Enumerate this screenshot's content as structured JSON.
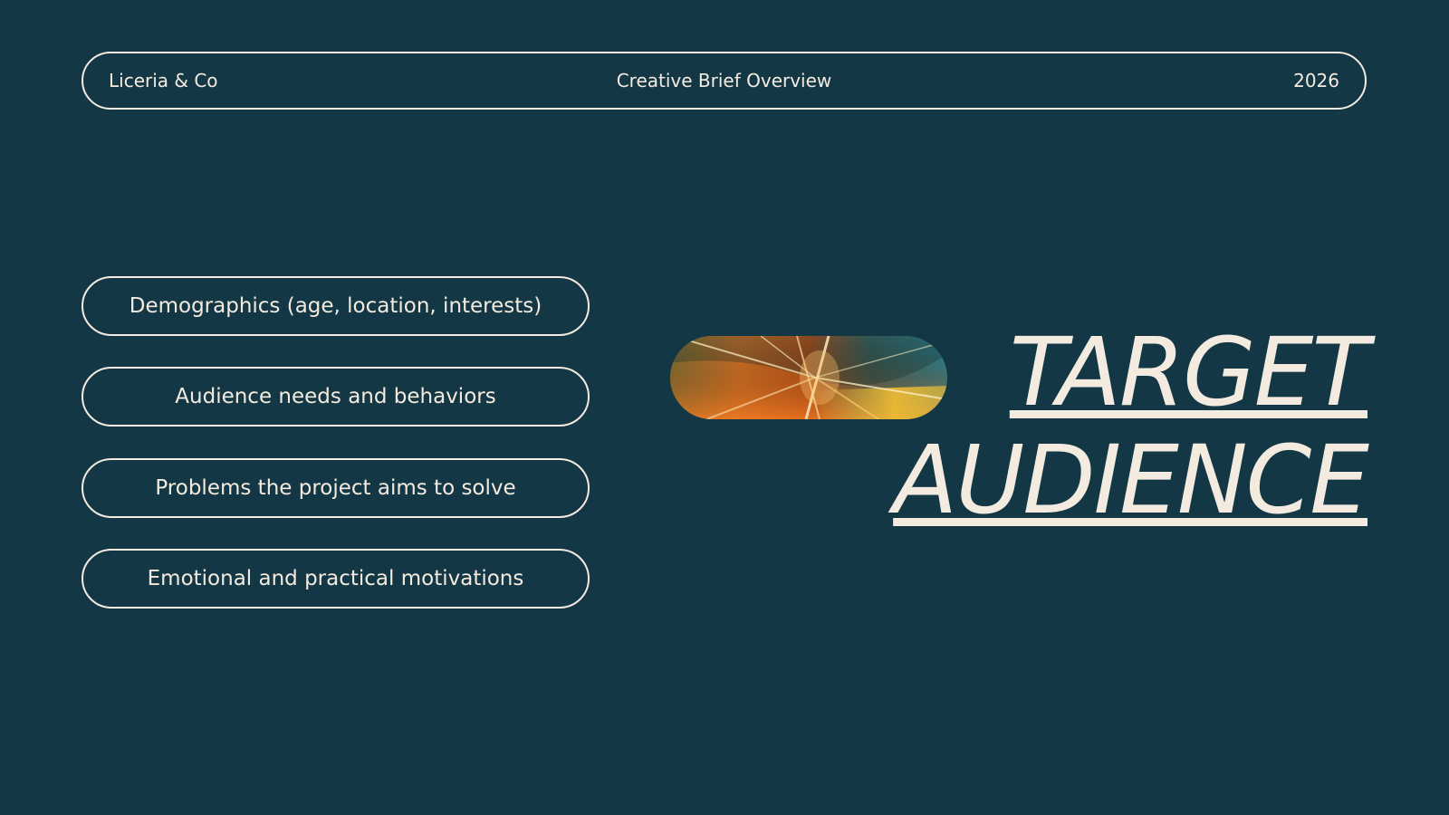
{
  "header": {
    "company": "Liceria & Co",
    "document_title": "Creative Brief Overview",
    "year": "2026"
  },
  "points": [
    {
      "label": "Demographics (age, location, interests)"
    },
    {
      "label": "Audience needs and behaviors"
    },
    {
      "label": "Problems the project aims to solve"
    },
    {
      "label": "Emotional and practical motivations"
    }
  ],
  "title": {
    "line1": "TARGET",
    "line2": "AUDIENCE"
  },
  "colors": {
    "background": "#143745",
    "foreground": "#f3ebdf"
  }
}
